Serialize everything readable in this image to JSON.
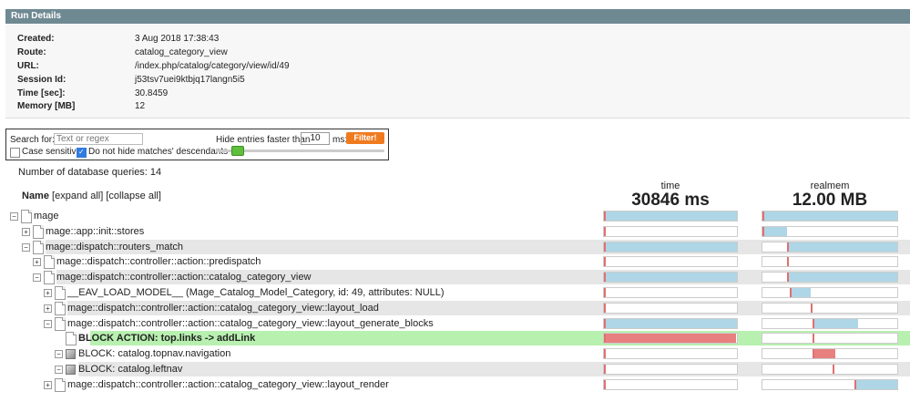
{
  "header": {
    "title": "Run Details"
  },
  "details": [
    {
      "key": "Created:",
      "value": "3 Aug 2018 17:38:43"
    },
    {
      "key": "Route:",
      "value": "catalog_category_view"
    },
    {
      "key": "URL:",
      "value": "/index.php/catalog/category/view/id/49"
    },
    {
      "key": "Session Id:",
      "value": "j53tsv7uei9ktbjq17langn5i5"
    },
    {
      "key": "Time [sec]:",
      "value": "30.8459"
    },
    {
      "key": "Memory [MB]",
      "value": "12"
    }
  ],
  "filter": {
    "search_label": "Search for:",
    "search_placeholder": "Text or regex",
    "case_sensitive_label": "Case sensitive",
    "case_sensitive_checked": false,
    "descendants_label": "Do not hide matches' descendants",
    "descendants_checked": true,
    "hide_label": "Hide entries faster than",
    "threshold": "10",
    "unit": "ms:",
    "button": "Filter!"
  },
  "db_queries": "Number of database queries: 14",
  "tree_header": {
    "name": "Name",
    "expand": "[expand all]",
    "collapse": "[collapse all]"
  },
  "columns": {
    "time": {
      "label": "time",
      "total": "30846 ms"
    },
    "realmem": {
      "label": "realmem",
      "total": "12.00 MB"
    }
  },
  "colors": {
    "fill_blue": "#aed6e6",
    "fill_red": "#e88080",
    "highlight_row": "#b8f0b0",
    "shade_row": "#e6e6e6"
  },
  "rows": [
    {
      "label": "mage",
      "depth": 0,
      "toggle": "−",
      "icon": "doc",
      "bold": false,
      "highlight": false,
      "time": {
        "start": 0,
        "width": 1.0,
        "color": "blue"
      },
      "mem": {
        "start": 0,
        "width": 1.0,
        "color": "blue"
      }
    },
    {
      "label": "mage::app::init::stores",
      "depth": 1,
      "toggle": "+",
      "icon": "doc",
      "bold": false,
      "highlight": false,
      "time": {
        "start": 0,
        "width": 0.003,
        "color": "blue"
      },
      "mem": {
        "start": 0,
        "width": 0.18,
        "color": "blue"
      }
    },
    {
      "label": "mage::dispatch::routers_match",
      "depth": 1,
      "toggle": "−",
      "icon": "doc",
      "bold": false,
      "highlight": false,
      "time": {
        "start": 0,
        "width": 0.997,
        "color": "blue"
      },
      "mem": {
        "start": 0.18,
        "width": 0.82,
        "color": "blue"
      }
    },
    {
      "label": "mage::dispatch::controller::action::predispatch",
      "depth": 2,
      "toggle": "+",
      "icon": "doc",
      "bold": false,
      "highlight": false,
      "time": {
        "start": 0,
        "width": 0.002,
        "color": "blue"
      },
      "mem": {
        "start": 0.18,
        "width": 0.005,
        "color": "blue"
      }
    },
    {
      "label": "mage::dispatch::controller::action::catalog_category_view",
      "depth": 2,
      "toggle": "−",
      "icon": "doc",
      "bold": false,
      "highlight": false,
      "time": {
        "start": 0,
        "width": 0.997,
        "color": "blue"
      },
      "mem": {
        "start": 0.18,
        "width": 0.82,
        "color": "blue"
      }
    },
    {
      "label": "__EAV_LOAD_MODEL__ (Mage_Catalog_Model_Category, id: 49, attributes: NULL)",
      "depth": 3,
      "toggle": "+",
      "icon": "doc",
      "bold": false,
      "highlight": false,
      "time": {
        "start": 0,
        "width": 0.002,
        "color": "blue"
      },
      "mem": {
        "start": 0.2,
        "width": 0.16,
        "color": "blue"
      }
    },
    {
      "label": "mage::dispatch::controller::action::catalog_category_view::layout_load",
      "depth": 3,
      "toggle": "+",
      "icon": "doc",
      "bold": false,
      "highlight": false,
      "time": {
        "start": 0,
        "width": 0.003,
        "color": "blue"
      },
      "mem": {
        "start": 0.36,
        "width": 0.005,
        "color": "blue"
      }
    },
    {
      "label": "mage::dispatch::controller::action::catalog_category_view::layout_generate_blocks",
      "depth": 3,
      "toggle": "−",
      "icon": "doc",
      "bold": false,
      "highlight": false,
      "time": {
        "start": 0,
        "width": 0.997,
        "color": "blue"
      },
      "mem": {
        "start": 0.37,
        "width": 0.34,
        "color": "blue"
      }
    },
    {
      "label": "BLOCK ACTION: top.links -> addLink",
      "depth": 4,
      "toggle": "",
      "icon": "doc",
      "bold": true,
      "highlight": true,
      "time": {
        "start": 0,
        "width": 0.99,
        "color": "red"
      },
      "mem": {
        "start": 0.37,
        "width": 0.005,
        "color": "blue"
      }
    },
    {
      "label": "BLOCK: catalog.topnav.navigation",
      "depth": 4,
      "toggle": "−",
      "icon": "cube",
      "bold": false,
      "highlight": false,
      "time": {
        "start": 0,
        "width": 0.002,
        "color": "blue"
      },
      "mem": {
        "start": 0.37,
        "width": 0.17,
        "color": "red"
      }
    },
    {
      "label": "BLOCK: catalog.leftnav",
      "depth": 4,
      "toggle": "−",
      "icon": "cube",
      "bold": false,
      "highlight": false,
      "time": {
        "start": 0,
        "width": 0.002,
        "color": "blue"
      },
      "mem": {
        "start": 0.52,
        "width": 0.005,
        "color": "blue"
      }
    },
    {
      "label": "mage::dispatch::controller::action::catalog_category_view::layout_render",
      "depth": 3,
      "toggle": "+",
      "icon": "doc",
      "bold": false,
      "highlight": false,
      "time": {
        "start": 0,
        "width": 0.002,
        "color": "blue"
      },
      "mem": {
        "start": 0.68,
        "width": 0.32,
        "color": "blue"
      }
    }
  ]
}
